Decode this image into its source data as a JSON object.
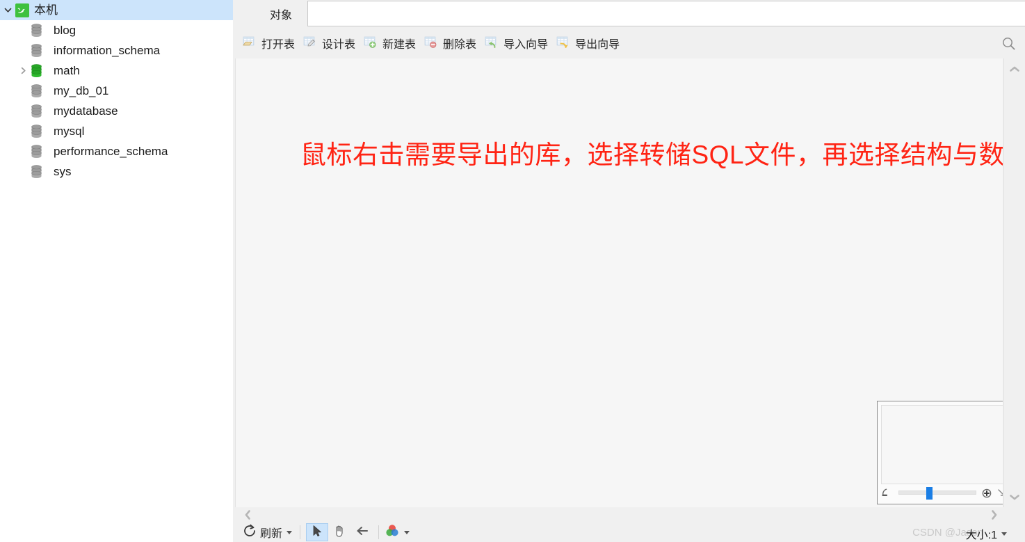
{
  "sidebar": {
    "connection": {
      "label": "本机",
      "icon": "mysql-dolphin-icon",
      "expanded": true,
      "selected": true
    },
    "databases": [
      {
        "label": "blog",
        "icon": "database-icon",
        "state": "closed",
        "expandable": false
      },
      {
        "label": "information_schema",
        "icon": "database-icon",
        "state": "closed",
        "expandable": false
      },
      {
        "label": "math",
        "icon": "database-icon-open",
        "state": "open",
        "expandable": true
      },
      {
        "label": "my_db_01",
        "icon": "database-icon",
        "state": "closed",
        "expandable": false
      },
      {
        "label": "mydatabase",
        "icon": "database-icon",
        "state": "closed",
        "expandable": false
      },
      {
        "label": "mysql",
        "icon": "database-icon",
        "state": "closed",
        "expandable": false
      },
      {
        "label": "performance_schema",
        "icon": "database-icon",
        "state": "closed",
        "expandable": false
      },
      {
        "label": "sys",
        "icon": "database-icon",
        "state": "closed",
        "expandable": false
      }
    ]
  },
  "tabs": {
    "active": "对象",
    "items": [
      {
        "label": "对象"
      }
    ]
  },
  "toolbar": {
    "buttons": [
      {
        "label": "打开表",
        "icon": "open-table-icon"
      },
      {
        "label": "设计表",
        "icon": "design-table-icon"
      },
      {
        "label": "新建表",
        "icon": "new-table-icon"
      },
      {
        "label": "删除表",
        "icon": "delete-table-icon"
      },
      {
        "label": "导入向导",
        "icon": "import-wizard-icon"
      },
      {
        "label": "导出向导",
        "icon": "export-wizard-icon"
      }
    ],
    "search_icon": "search-icon"
  },
  "canvas": {
    "note": "鼠标右击需要导出的库，选择转储SQL文件，再选择结构与数据",
    "note_color": "#ff2414",
    "background": "#f6f6f6"
  },
  "navigator": {
    "zoom_out_icon": "zoom-out-magnifier-icon",
    "zoom_in_icon": "zoom-in-magnifier-icon",
    "resize_icon": "resize-handle-icon",
    "slider_value": 35
  },
  "scrollbars": {
    "vertical_up_icon": "chevron-up-icon",
    "vertical_down_icon": "chevron-down-icon",
    "horizontal_left_icon": "chevron-left-icon",
    "horizontal_right_icon": "chevron-right-icon"
  },
  "statusbar": {
    "refresh_label": "刷新",
    "refresh_icon": "refresh-icon",
    "tools": [
      {
        "name": "pointer-tool",
        "icon": "pointer-arrow-icon",
        "active": true
      },
      {
        "name": "hand-tool",
        "icon": "hand-icon",
        "active": false
      },
      {
        "name": "link-tool",
        "icon": "link-arrow-icon",
        "active": false
      }
    ],
    "color_icon": "color-wheel-icon",
    "size_label": "大小:1",
    "watermark": "CSDN @Jason"
  },
  "colors": {
    "selection": "#cce4fb",
    "accent_green": "#3ec13e",
    "note_red": "#ff2414",
    "chrome": "#f0f0f0"
  }
}
